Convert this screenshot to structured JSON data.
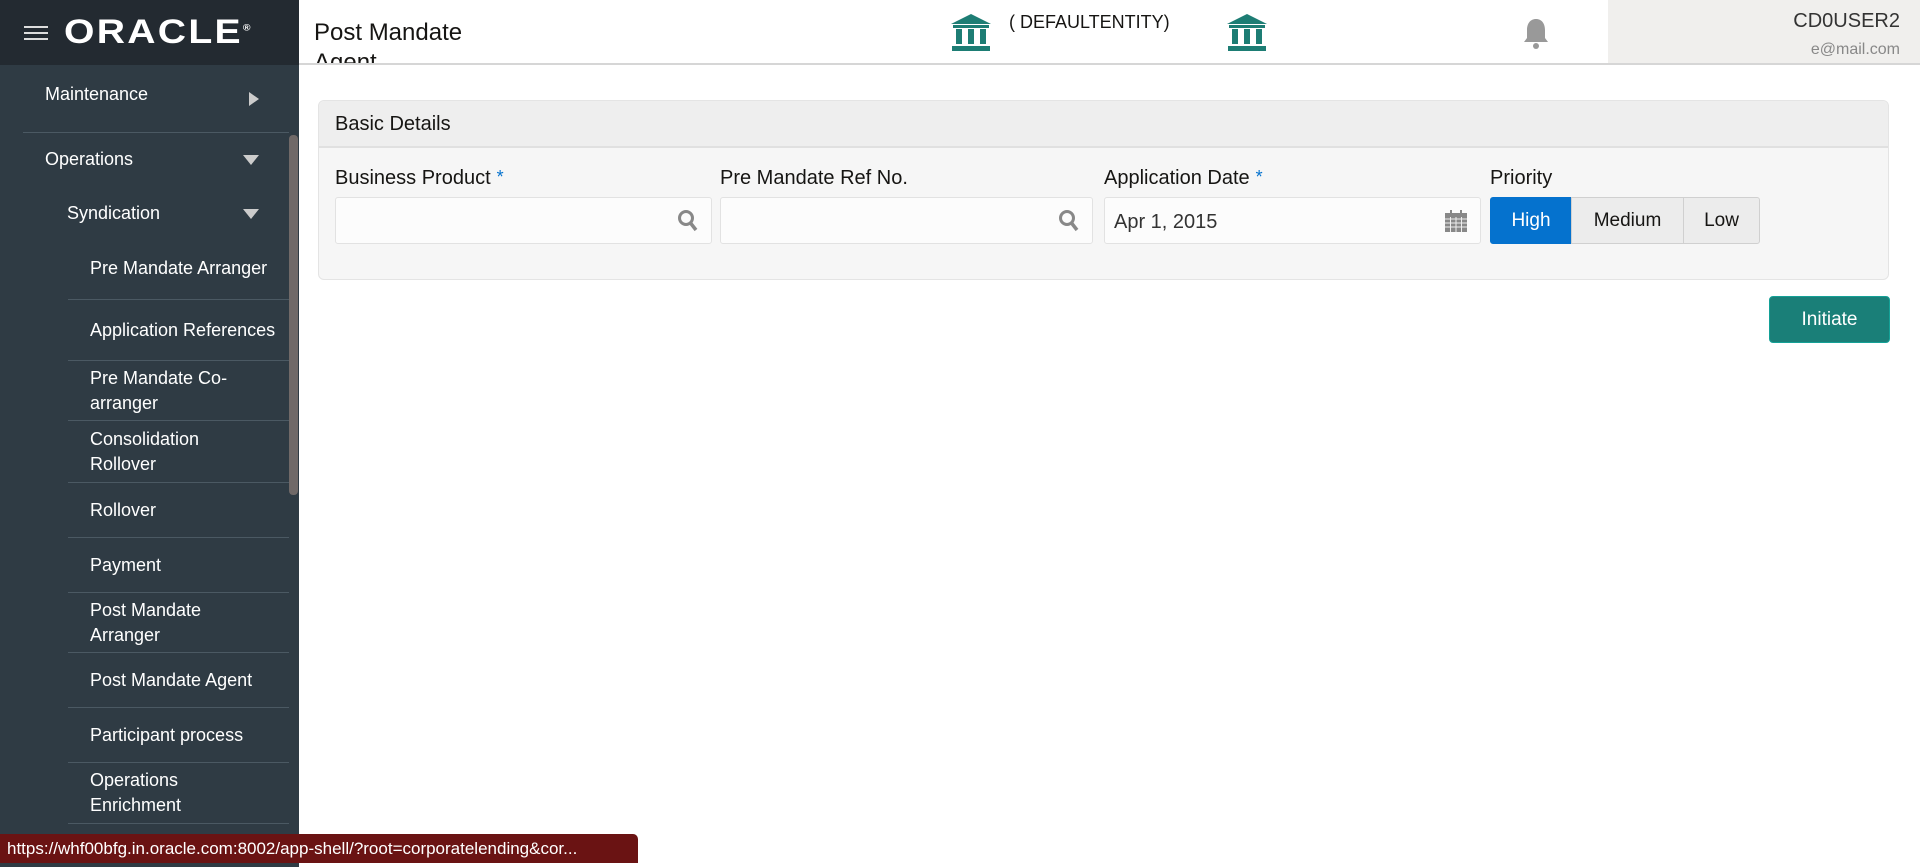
{
  "brand": {
    "logo": "ORACLE"
  },
  "header": {
    "title": "Post Mandate Agent",
    "entity": "( DEFAULTENTITY)",
    "user": "CD0USER2",
    "email": "e@mail.com"
  },
  "sidebar": {
    "maintenance": "Maintenance",
    "operations": "Operations",
    "syndication": "Syndication",
    "items": [
      "Pre Mandate Arranger",
      "Application References",
      "Pre Mandate Co-arranger",
      "Consolidation Rollover",
      "Rollover",
      "Payment",
      "Post Mandate Arranger",
      "Post Mandate Agent",
      "Participant process",
      "Operations Enrichment"
    ]
  },
  "form": {
    "section": "Basic Details",
    "business_product": {
      "label": "Business Product",
      "required": "*",
      "value": ""
    },
    "ref_no": {
      "label": "Pre Mandate Ref No.",
      "value": ""
    },
    "app_date": {
      "label": "Application Date",
      "required": "*",
      "value": "Apr 1, 2015"
    },
    "priority": {
      "label": "Priority",
      "options": [
        "High",
        "Medium",
        "Low"
      ],
      "selected": "High"
    },
    "initiate": "Initiate"
  },
  "status_url": "https://whf00bfg.in.oracle.com:8002/app-shell/?root=corporatelending&cor...",
  "colors": {
    "accent": "#0572ce",
    "teal": "#1a7f78",
    "sidebar": "#2f3b44"
  }
}
